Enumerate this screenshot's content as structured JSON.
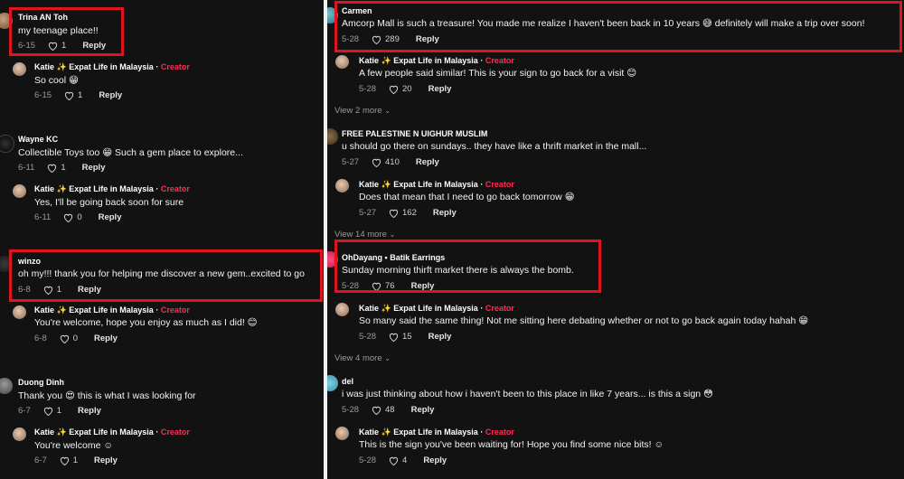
{
  "left": {
    "c1": {
      "author": "Trina AN Toh",
      "text": "my teenage place!!",
      "date": "6-15",
      "likes": "1",
      "reply": "Reply"
    },
    "r1": {
      "author": "Katie",
      "sparkle": "✨",
      "tagline": "Expat Life in Malaysia",
      "dot": "·",
      "creator": "Creator",
      "text": "So cool 😁",
      "date": "6-15",
      "likes": "1",
      "reply": "Reply"
    },
    "c2": {
      "author": "Wayne KC",
      "text": "Collectible Toys too 😁  Such a gem place to explore...",
      "date": "6-11",
      "likes": "1",
      "reply": "Reply"
    },
    "r2": {
      "author": "Katie",
      "sparkle": "✨",
      "tagline": "Expat Life in Malaysia",
      "dot": "·",
      "creator": "Creator",
      "text": "Yes, I'll be going back soon for sure",
      "date": "6-11",
      "likes": "0",
      "reply": "Reply"
    },
    "c3": {
      "author": "winzo",
      "text": "oh my!!! thank you for helping me discover a new gem..excited to go",
      "date": "6-8",
      "likes": "1",
      "reply": "Reply"
    },
    "r3": {
      "author": "Katie",
      "sparkle": "✨",
      "tagline": "Expat Life in Malaysia",
      "dot": "·",
      "creator": "Creator",
      "text": "You're welcome, hope you enjoy as much as I did! 😊",
      "date": "6-8",
      "likes": "0",
      "reply": "Reply"
    },
    "c4": {
      "author": "Duong Dinh",
      "text": "Thank you 😍  this is what I was looking for",
      "date": "6-7",
      "likes": "1",
      "reply": "Reply"
    },
    "r4": {
      "author": "Katie",
      "sparkle": "✨",
      "tagline": "Expat Life in Malaysia",
      "dot": "·",
      "creator": "Creator",
      "text": "You're welcome ☺",
      "date": "6-7",
      "likes": "1",
      "reply": "Reply"
    }
  },
  "right": {
    "c1": {
      "author": "Carmen",
      "text": "Amcorp Mall is such a treasure! You made me realize I haven't been back in 10 years 😅  definitely will make a trip over soon!",
      "date": "5-28",
      "likes": "289",
      "reply": "Reply"
    },
    "r1": {
      "author": "Katie",
      "sparkle": "✨",
      "tagline": "Expat Life in Malaysia",
      "dot": "·",
      "creator": "Creator",
      "text": "A few people said similar! This is your sign to go back for a visit 😊",
      "date": "5-28",
      "likes": "20",
      "reply": "Reply"
    },
    "vm1": {
      "label": "View 2 more",
      "chevron": "⌄"
    },
    "c2": {
      "author": "FREE PALESTINE N UIGHUR MUSLIM",
      "text": "u should go there on sundays.. they have like a thrift market in the mall...",
      "date": "5-27",
      "likes": "410",
      "reply": "Reply"
    },
    "r2": {
      "author": "Katie",
      "sparkle": "✨",
      "tagline": "Expat Life in Malaysia",
      "dot": "·",
      "creator": "Creator",
      "text": "Does that mean that I need to go back tomorrow 😁",
      "date": "5-27",
      "likes": "162",
      "reply": "Reply"
    },
    "vm2": {
      "label": "View 14 more",
      "chevron": "⌄"
    },
    "c3": {
      "author": "OhDayang",
      "dot": "•",
      "tagline": "Batik Earrings",
      "text": "Sunday morning thirft market there is always the bomb.",
      "date": "5-28",
      "likes": "76",
      "reply": "Reply"
    },
    "r3": {
      "author": "Katie",
      "sparkle": "✨",
      "tagline": "Expat Life in Malaysia",
      "dot": "·",
      "creator": "Creator",
      "text": "So many said the same thing! Not me sitting here debating whether or not to go back again today hahah 😁",
      "date": "5-28",
      "likes": "15",
      "reply": "Reply"
    },
    "vm3": {
      "label": "View 4 more",
      "chevron": "⌄"
    },
    "c4": {
      "author": "del",
      "text": "i was just thinking about how i haven't been to this place in like 7 years... is this a sign 😳",
      "date": "5-28",
      "likes": "48",
      "reply": "Reply"
    },
    "r4": {
      "author": "Katie",
      "sparkle": "✨",
      "tagline": "Expat Life in Malaysia",
      "dot": "·",
      "creator": "Creator",
      "text": "This is the sign you've been waiting for! Hope you find some nice bits! ☺",
      "date": "5-28",
      "likes": "4",
      "reply": "Reply"
    }
  },
  "colors": {
    "background": "#121212",
    "highlight": "#e0141e",
    "creator": "#fe2c55",
    "divider": "#f0f0f0"
  },
  "icons": {
    "like": "heart-outline-icon",
    "expand": "chevron-down-icon"
  }
}
